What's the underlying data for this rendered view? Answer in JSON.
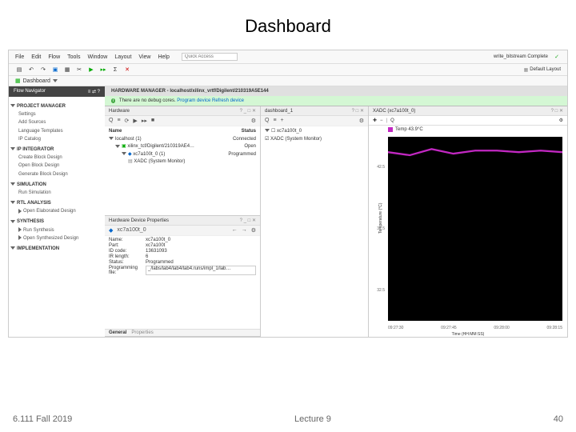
{
  "slide": {
    "title": "Dashboard"
  },
  "footer": {
    "left": "6.111 Fall 2019",
    "center": "Lecture 9",
    "right": "40"
  },
  "menu": [
    "File",
    "Edit",
    "Flow",
    "Tools",
    "Window",
    "Layout",
    "View",
    "Help"
  ],
  "quick_access_ph": "Quick Access",
  "dashboard_btn": {
    "label": "Dashboard"
  },
  "status_right": "write_bitstream Complete",
  "layout_btn": "Default Layout",
  "nav": {
    "title": "Flow Navigator",
    "sections": [
      {
        "label": "PROJECT MANAGER",
        "open": true,
        "items": [
          "Settings",
          "Add Sources",
          "Language Templates",
          "IP Catalog"
        ]
      },
      {
        "label": "IP INTEGRATOR",
        "open": true,
        "items": [
          "Create Block Design",
          "Open Block Design",
          "Generate Block Design"
        ]
      },
      {
        "label": "SIMULATION",
        "open": true,
        "items": [
          "Run Simulation"
        ]
      },
      {
        "label": "RTL ANALYSIS",
        "open": true,
        "items": [
          "Open Elaborated Design"
        ],
        "sub": true
      },
      {
        "label": "SYNTHESIS",
        "open": true,
        "items": [
          "Run Synthesis",
          "Open Synthesized Design"
        ],
        "sub": true
      },
      {
        "label": "IMPLEMENTATION",
        "open": true,
        "items": []
      }
    ]
  },
  "mgr": {
    "title": "HARDWARE MANAGER - localhost/xilinx_vrtf/Digilent/210319A5E144"
  },
  "info": {
    "msg": "There are no debug cores.",
    "link1": "Program device",
    "link2": "Refresh device"
  },
  "hw_panel": {
    "title": "Hardware",
    "cols": {
      "name": "Name",
      "status": "Status"
    },
    "rows": [
      {
        "ind": 0,
        "name": "localhost (1)",
        "status": "Connected"
      },
      {
        "ind": 1,
        "name": "xilinx_tcf/Digilent/210319AE4…",
        "status": "Open"
      },
      {
        "ind": 2,
        "name": "xc7a100t_0 (1)",
        "status": "Programmed"
      },
      {
        "ind": 3,
        "name": "XADC (System Monitor)",
        "status": ""
      }
    ]
  },
  "props_panel": {
    "title": "Hardware Device Properties",
    "device": "xc7a100t_0",
    "rows": [
      {
        "k": "Name:",
        "v": "xc7a100t_0"
      },
      {
        "k": "Part:",
        "v": "xc7a100t"
      },
      {
        "k": "ID code:",
        "v": "13631093"
      },
      {
        "k": "IR length:",
        "v": "6"
      },
      {
        "k": "Status:",
        "v": "Programmed"
      },
      {
        "k": "Programming file:",
        "v": "_/labs/lab4/lab4/lab4.runs/impl_1/lab…"
      }
    ],
    "tabs": [
      "General",
      "Properties"
    ]
  },
  "dash_panel": {
    "title": "dashboard_1",
    "tree": [
      {
        "ind": 0,
        "name": "xc7a100t_0"
      },
      {
        "ind": 1,
        "name": "XADC (System Monitor)",
        "sel": true
      }
    ]
  },
  "xadc_panel": {
    "title": "XADC (xc7a100t_0)",
    "legend": "Temp 43.9°C",
    "yticks": [
      "",
      "42.5",
      "",
      "37.5",
      "",
      "32.5",
      ""
    ],
    "ylabel": "Temperature (°C)",
    "xticks": [
      "09:27:30",
      "09:27:45",
      "09:28:00",
      "09:28:15"
    ],
    "xlabel": "Time (HH:MM:SS)"
  },
  "chart_data": {
    "type": "line",
    "title": "XADC (xc7a100t_0)",
    "xlabel": "Time (HH:MM:SS)",
    "ylabel": "Temperature (°C)",
    "ylim": [
      30,
      45
    ],
    "x": [
      "09:27:30",
      "09:27:45",
      "09:28:00",
      "09:28:15"
    ],
    "series": [
      {
        "name": "Temp",
        "current_label": "Temp 43.9°C",
        "color": "#c228c2",
        "values": [
          43.7,
          43.5,
          44.0,
          43.6,
          43.8,
          43.9,
          43.7,
          43.9
        ]
      }
    ]
  }
}
